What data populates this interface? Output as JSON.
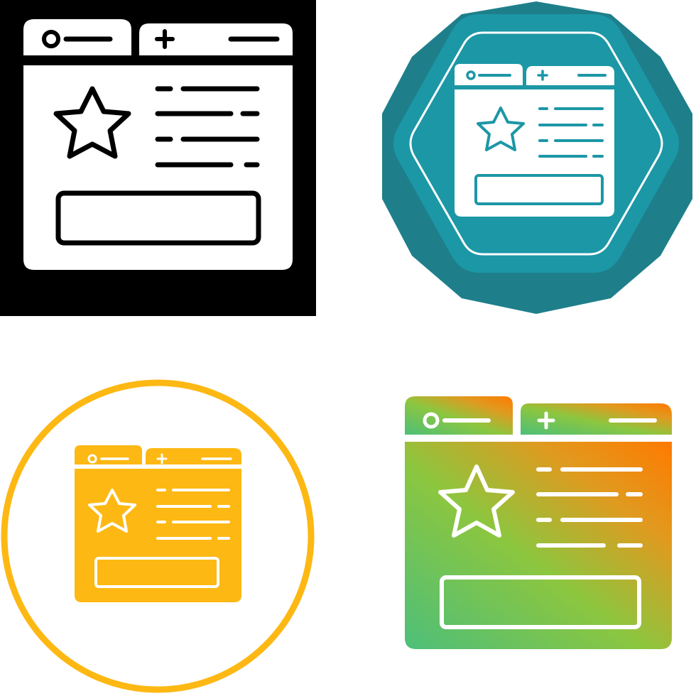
{
  "icons": [
    {
      "variant": "glyph-on-black-square",
      "icon": "web-browser-favorite-star-icon",
      "colors": {
        "background": "#000000",
        "icon": "#ffffff"
      }
    },
    {
      "variant": "glyph-on-teal-badge",
      "icon": "web-browser-favorite-star-icon",
      "colors": {
        "badge_outer": "#1e7f8b",
        "badge_inner": "#1c97a6",
        "icon": "#ffffff"
      }
    },
    {
      "variant": "glyph-in-orange-circle",
      "icon": "web-browser-favorite-star-icon",
      "colors": {
        "ring": "#fdb813",
        "icon": "#fdb813"
      }
    },
    {
      "variant": "gradient-glyph",
      "icon": "web-browser-favorite-star-icon",
      "colors": {
        "gradient_start": "#8cc63f",
        "gradient_end": "#ff8a00"
      }
    }
  ]
}
